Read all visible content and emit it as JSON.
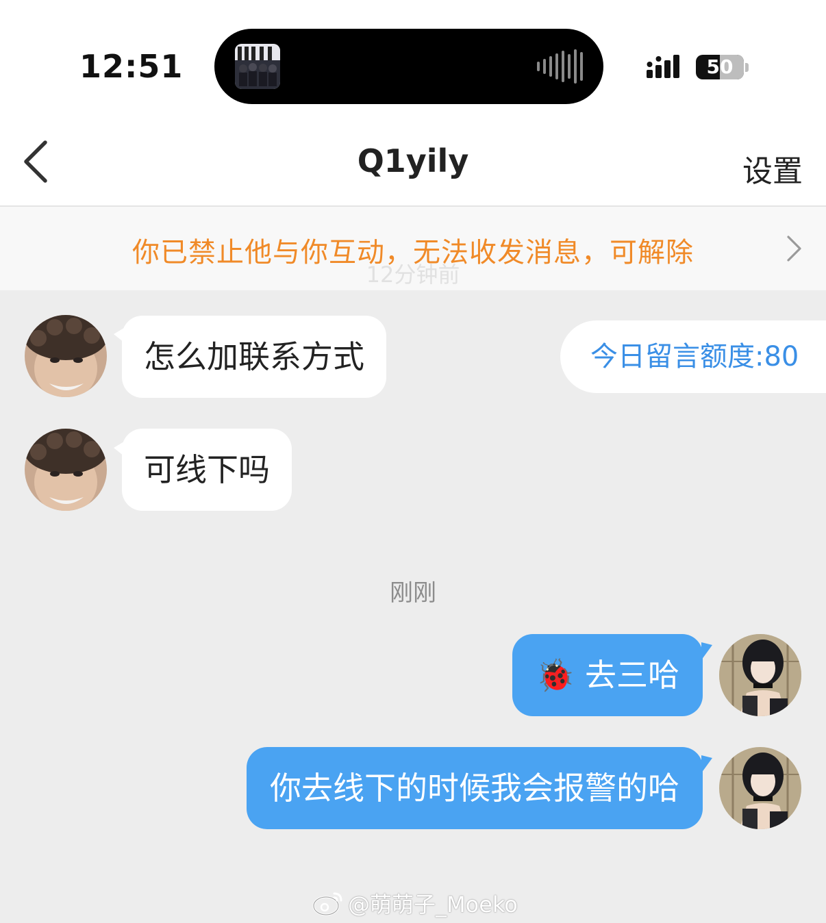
{
  "status_bar": {
    "time": "12:51",
    "battery_percent": "50"
  },
  "nav": {
    "title": "Q1yily",
    "settings_label": "设置"
  },
  "block_banner": {
    "text": "你已禁止他与你互动，无法收发消息，可解除",
    "faded_timestamp": "12分钟前"
  },
  "quota": {
    "label": "今日留言额度:80"
  },
  "messages": [
    {
      "side": "incoming",
      "text": "怎么加联系方式"
    },
    {
      "side": "incoming",
      "text": "可线下吗"
    },
    {
      "side": "outgoing",
      "emoji": "🐞",
      "text": "去三哈"
    },
    {
      "side": "outgoing",
      "text": "你去线下的时候我会报警的哈"
    }
  ],
  "time_divider": "刚刚",
  "watermark": "@萌萌子_Moeko",
  "colors": {
    "banner_text": "#f08a28",
    "outgoing_bubble": "#4aa3f2",
    "quota_text": "#3a8fe6",
    "chat_background": "#ededed"
  }
}
